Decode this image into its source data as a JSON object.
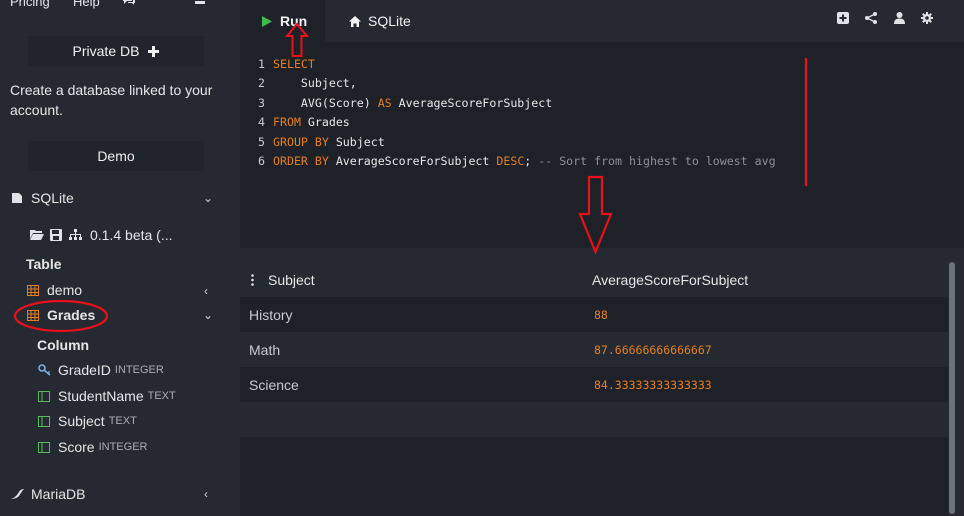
{
  "top_nav": {
    "pricing": "Pricing",
    "help": "Help"
  },
  "sidebar": {
    "private_db_label": "Private DB",
    "create_text": "Create a database linked to your account.",
    "demo_label": "Demo",
    "sqlite_label": "SQLite",
    "version_label": "0.1.4 beta (...",
    "table_heading": "Table",
    "tables": [
      {
        "name": "demo"
      },
      {
        "name": "Grades"
      }
    ],
    "column_heading": "Column",
    "columns": [
      {
        "name": "GradeID",
        "type": "INTEGER"
      },
      {
        "name": "StudentName",
        "type": "TEXT"
      },
      {
        "name": "Subject",
        "type": "TEXT"
      },
      {
        "name": "Score",
        "type": "INTEGER"
      }
    ],
    "mariadb_label": "MariaDB"
  },
  "toolbar": {
    "run_label": "Run",
    "sqlite_tab_label": "SQLite"
  },
  "editor": {
    "lines": [
      {
        "num": "1",
        "kw1": "SELECT",
        "rest": ""
      },
      {
        "num": "2",
        "indent": "    ",
        "text": "Subject,"
      },
      {
        "num": "3",
        "indent": "    ",
        "fn": "AVG(Score) ",
        "kw": "AS",
        "rest": " AverageScoreForSubject"
      },
      {
        "num": "4",
        "kw1": "FROM",
        "rest": " Grades"
      },
      {
        "num": "5",
        "kw1": "GROUP BY",
        "rest": " Subject"
      },
      {
        "num": "6",
        "kw1": "ORDER BY",
        "mid": " AverageScoreForSubject ",
        "kw2": "DESC",
        "semi": ";",
        "comment": " -- Sort from highest to lowest avg"
      }
    ]
  },
  "results": {
    "columns": [
      "Subject",
      "AverageScoreForSubject"
    ],
    "rows": [
      {
        "subject": "History",
        "avg": "88"
      },
      {
        "subject": "Math",
        "avg": "87.66666666666667"
      },
      {
        "subject": "Science",
        "avg": "84.33333333333333"
      }
    ]
  },
  "colors": {
    "accent_orange": "#e67e22",
    "run_green": "#3fb950",
    "annotation_red": "#e8101a"
  }
}
